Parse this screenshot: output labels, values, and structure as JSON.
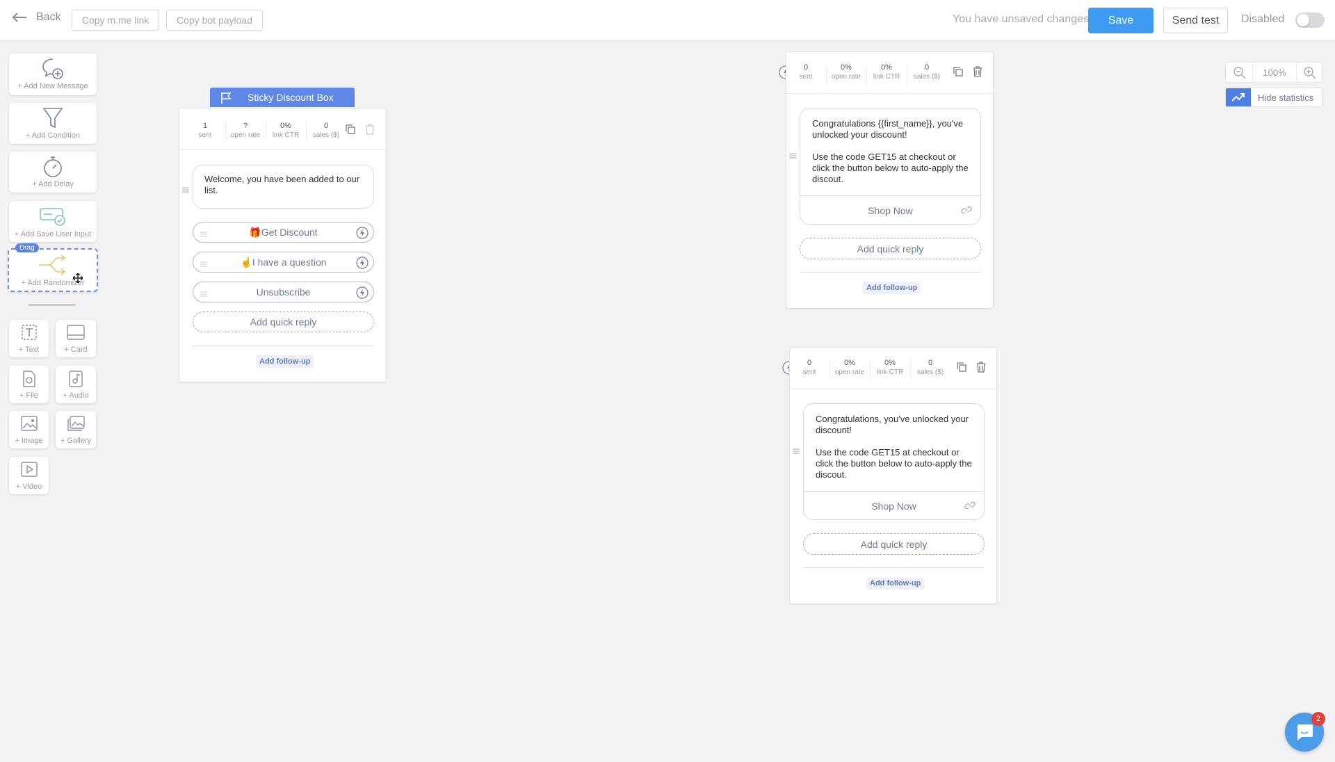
{
  "topbar": {
    "back_label": "Back",
    "copy_link_label": "Copy m.me link",
    "copy_payload_label": "Copy bot payload",
    "unsaved_text": "You have unsaved changes.",
    "save_label": "Save",
    "send_test_label": "Send test",
    "status_label": "Disabled",
    "enabled": false
  },
  "toolbox": {
    "add_message": "+ Add New Message",
    "add_condition": "+ Add Condition",
    "add_delay": "+ Add Delay",
    "add_save_input": "+ Add Save User Input",
    "add_randomizer": "+ Add Randomizer",
    "drag_badge": "Drag",
    "text": "+ Text",
    "card": "+ Card",
    "file": "+ File",
    "audio": "+ Audio",
    "image": "+ Image",
    "gallery": "+ Gallery",
    "video": "+ Video"
  },
  "stat_labels": {
    "sent": "sent",
    "open_rate": "open rate",
    "link_ctr": "link CTR",
    "sales": "sales ($)"
  },
  "node1": {
    "flag_title": "Sticky Discount Box",
    "sent": "1",
    "open_rate": "?",
    "link_ctr": "0%",
    "sales": "0",
    "message": "Welcome, you have been added to our list.",
    "buttons": [
      "🎁Get Discount",
      "☝️I have a question",
      "Unsubscribe"
    ],
    "add_quick_reply": "Add quick reply",
    "add_follow_up": "Add follow-up"
  },
  "node2": {
    "sent": "0",
    "open_rate": "0%",
    "link_ctr": "0%",
    "sales": "0",
    "message_line1": "Congratulations {{first_name}}, you've unlocked your discount!",
    "message_line2": "Use the code GET15 at checkout or click the button below to auto-apply the discout.",
    "button": "Shop Now",
    "add_quick_reply": "Add quick reply",
    "add_follow_up": "Add follow-up"
  },
  "node3": {
    "sent": "0",
    "open_rate": "0%",
    "link_ctr": "0%",
    "sales": "0",
    "message_line1": "Congratulations, you've unlocked your discount!",
    "message_line2": "Use the code GET15 at checkout or click the button below to auto-apply the discout.",
    "button": "Shop Now",
    "add_quick_reply": "Add quick reply",
    "add_follow_up": "Add follow-up"
  },
  "zoom": {
    "level": "100%",
    "hide_statistics": "Hide statistics"
  },
  "chat": {
    "badge_count": "2"
  },
  "colors": {
    "primary": "#3f9bf1",
    "flag": "#5e88e6",
    "canvas": "#f2f2f4"
  }
}
